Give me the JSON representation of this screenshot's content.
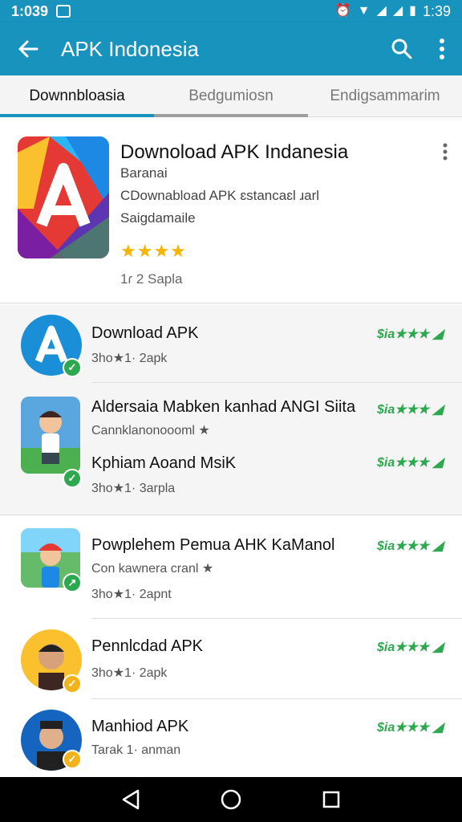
{
  "status_bar": {
    "time_left": "1:039",
    "time_right": "1:39"
  },
  "app_bar": {
    "title": "APK Indonesia"
  },
  "tabs": [
    {
      "label": "Downnbloasia"
    },
    {
      "label": "Bedgumiosn"
    },
    {
      "label": "Endigsammarim"
    }
  ],
  "featured": {
    "title": "Downoload APK Indanesia",
    "line1": "Baranai",
    "line2": "CDownabload APK ɛstancaɛl ɹarl",
    "line3": "Saigdamaile",
    "stars": "★★★★",
    "meta": "1ɾ 2 Sapla"
  },
  "apps": [
    {
      "name": "Download APK",
      "sub": "3ho★1· 2apk",
      "rating": "$ia★★★ ◢"
    },
    {
      "name": "Aldersaia Mabken kanhad ANGI Siita",
      "sub": "Cannklanonoooml ★",
      "rating": "$ia★★★ ◢"
    },
    {
      "name": "Kphiam Aoand MsiK",
      "sub": "3ho★1· 3arpla",
      "rating": "$ia★★★ ◢"
    },
    {
      "name": "Powplehem Pemua AHK KaManol",
      "sub": "Con kawnera cranl ★",
      "sub2": "3ho★1· 2apnt",
      "rating": "$ia★★★ ◢"
    },
    {
      "name": "Pennlcdad APK",
      "sub": "3ho★1· 2apk",
      "rating": "$ia★★★ ◢"
    },
    {
      "name": "Manhiod APK",
      "sub": "Tarak 1· anman",
      "rating": "$ia★★★ ◢"
    }
  ],
  "colors": {
    "primary": "#1793bd",
    "star": "#f4b400",
    "rating_green": "#2ea84f"
  }
}
